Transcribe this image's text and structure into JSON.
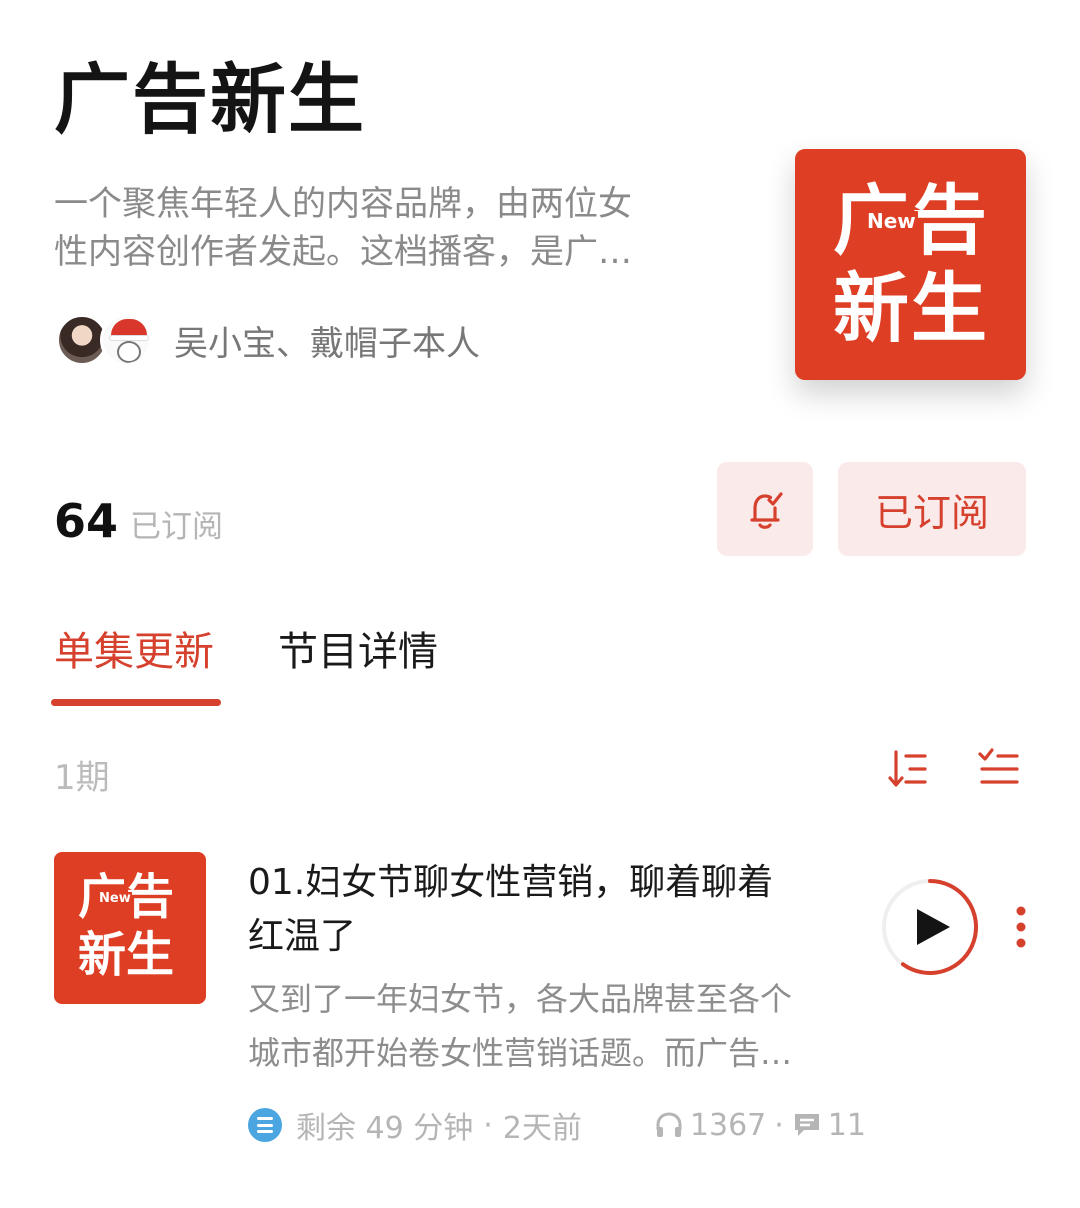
{
  "podcast": {
    "title": "广告新生",
    "description_line1": "一个聚焦年轻人的内容品牌，由两位女",
    "description_line2": "性内容创作者发起。这档播客，是广…",
    "hosts": "吴小宝、戴帽子本人",
    "cover_line1": "广告",
    "cover_line2": "新生",
    "cover_badge": "New"
  },
  "subscription": {
    "count": "64",
    "count_label": "已订阅",
    "subscribed_label": "已订阅"
  },
  "tabs": [
    {
      "label": "单集更新",
      "active": true
    },
    {
      "label": "节目详情",
      "active": false
    }
  ],
  "episode_list": {
    "count_label": "1期"
  },
  "episode": {
    "title_line1": "01.妇女节聊女性营销，聊着聊着",
    "title_line2": "红温了",
    "desc_line1": "又到了一年妇女节，各大品牌甚至各个",
    "desc_line2": "城市都开始卷女性营销话题。而广告…",
    "remaining": "剩余 49 分钟",
    "separator": "·",
    "published": "2天前",
    "plays": "1367",
    "comments": "11",
    "play_progress": 0.6
  },
  "colors": {
    "accent": "#d6412e",
    "cover_bg": "#de3e23",
    "button_bg": "#fbeaea",
    "list_icon": "#4aa5e0"
  }
}
